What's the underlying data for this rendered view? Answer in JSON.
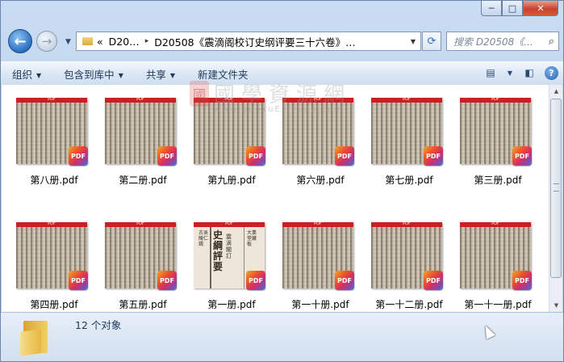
{
  "window": {
    "caption_buttons": {
      "minimize": "─",
      "maximize": "□",
      "close": "✕"
    }
  },
  "nav": {
    "back_glyph": "←",
    "forward_glyph": "→",
    "history_glyph": "▼"
  },
  "address": {
    "prefix": "«",
    "segments": [
      "D20…",
      "D20508《震滴阁校订史纲评要三十六卷》…"
    ],
    "separator": "▸",
    "dropdown": "▼"
  },
  "refresh_glyph": "⟳",
  "search": {
    "placeholder": "搜索 D20508《...",
    "icon": "⌕"
  },
  "toolbar": {
    "organize": "组织",
    "include_library": "包含到库中",
    "share": "共享",
    "new_folder": "新建文件夹",
    "arrow": "▼",
    "view_icon": "▤",
    "view_arrow": "▼",
    "preview_icon": "◧",
    "help": "?"
  },
  "files": [
    {
      "name": "第八册.pdf",
      "cover": "text"
    },
    {
      "name": "第二册.pdf",
      "cover": "text"
    },
    {
      "name": "第九册.pdf",
      "cover": "text"
    },
    {
      "name": "第六册.pdf",
      "cover": "text"
    },
    {
      "name": "第七册.pdf",
      "cover": "text"
    },
    {
      "name": "第三册.pdf",
      "cover": "text"
    },
    {
      "name": "第四册.pdf",
      "cover": "text"
    },
    {
      "name": "第五册.pdf",
      "cover": "text"
    },
    {
      "name": "第一册.pdf",
      "cover": "title"
    },
    {
      "name": "第一十册.pdf",
      "cover": "text"
    },
    {
      "name": "第一十二册.pdf",
      "cover": "text"
    },
    {
      "name": "第一十一册.pdf",
      "cover": "text"
    }
  ],
  "thumb": {
    "header": "PDF",
    "badge": "PDF",
    "title_page": {
      "main": "史綱評要",
      "side": "震滴閣訂",
      "small_left": "古吳陳仁錫",
      "small_right": "大業堂藏板"
    }
  },
  "watermark": {
    "logo": "國",
    "text": "國學資源網",
    "url": "www.guoxuEziyuan.com"
  },
  "scrollbar": {
    "up": "▲",
    "down": "▼"
  },
  "status": {
    "count": "12 个对象"
  },
  "colors": {
    "pdf_header": "#cc2020",
    "close_button": "#c7432b",
    "window_frame": "#b4cbe8"
  }
}
